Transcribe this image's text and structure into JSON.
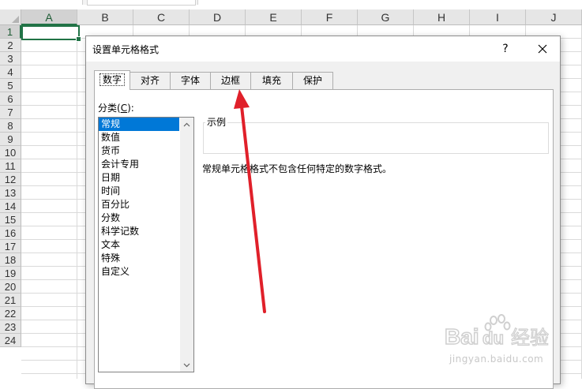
{
  "sheet": {
    "columns": [
      "A",
      "B",
      "C",
      "D",
      "E",
      "F",
      "G",
      "H",
      "I",
      "J"
    ],
    "rows": [
      "1",
      "2",
      "3",
      "4",
      "5",
      "6",
      "7",
      "8",
      "9",
      "10",
      "11",
      "12",
      "13",
      "14",
      "15",
      "16",
      "17",
      "18",
      "19",
      "20",
      "21",
      "22",
      "23",
      "24"
    ],
    "active_column": "A",
    "active_row": "1",
    "accent_color": "#217346"
  },
  "dialog": {
    "title": "设置单元格格式",
    "help_label": "?",
    "tabs": [
      "数字",
      "对齐",
      "字体",
      "边框",
      "填充",
      "保护"
    ],
    "active_tab": "数字",
    "category_label_pre": "分类(",
    "category_label_key": "C",
    "category_label_post": "):",
    "categories": [
      "常规",
      "数值",
      "货币",
      "会计专用",
      "日期",
      "时间",
      "百分比",
      "分数",
      "科学记数",
      "文本",
      "特殊",
      "自定义"
    ],
    "selected_category": "常规",
    "sample_label": "示例",
    "description": "常规单元格格式不包含任何特定的数字格式。"
  },
  "annotation": {
    "arrow_color": "#e0202a",
    "target": "边框"
  },
  "watermark": {
    "logo_text": "Bai",
    "logo_text2": "du",
    "logo_cn": "经验",
    "sub": "jingyan.baidu.com"
  }
}
